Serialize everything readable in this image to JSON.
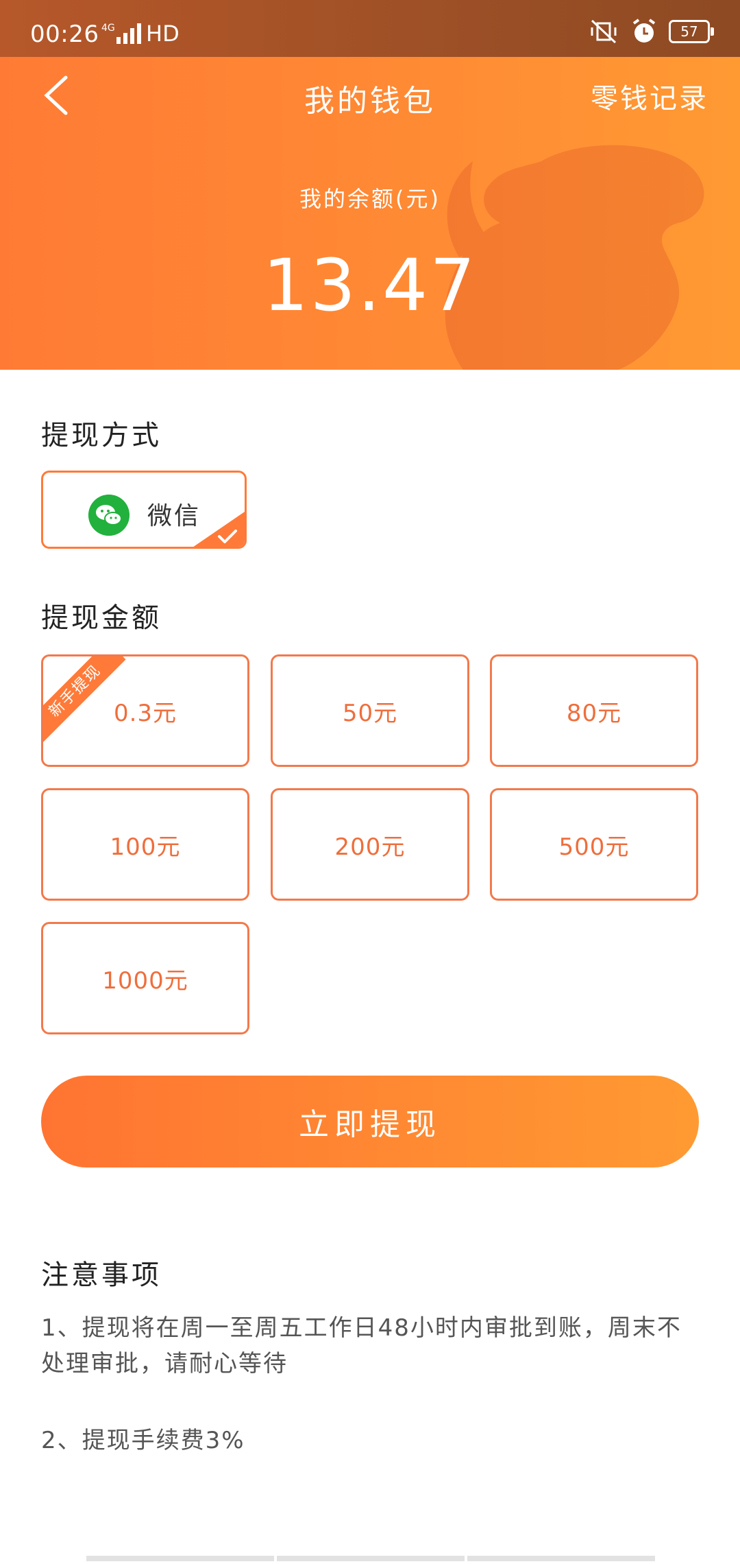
{
  "status_bar": {
    "time": "00:26",
    "network": "4G",
    "hd": "HD",
    "battery": "57",
    "icons": [
      "vibrate-icon",
      "alarm-icon",
      "battery-icon"
    ]
  },
  "nav": {
    "title": "我的钱包",
    "right_link": "零钱记录",
    "back_icon": "chevron-left-icon"
  },
  "balance": {
    "label": "我的余额(元)",
    "value": "13.47"
  },
  "withdraw_method": {
    "title": "提现方式",
    "option_label": "微信",
    "option_icon": "wechat-icon",
    "selected": true
  },
  "withdraw_amount": {
    "title": "提现金额",
    "options": [
      {
        "label": "0.3元",
        "badge": "新手提现"
      },
      {
        "label": "50元"
      },
      {
        "label": "80元"
      },
      {
        "label": "100元"
      },
      {
        "label": "200元"
      },
      {
        "label": "500元"
      },
      {
        "label": "1000元"
      }
    ]
  },
  "withdraw_button": "立即提现",
  "notes": {
    "title": "注意事项",
    "items": [
      "1、提现将在周一至周五工作日48小时内审批到账，周末不处理审批，请耐心等待",
      "2、提现手续费3%"
    ]
  },
  "colors": {
    "accent": "#ff7a38",
    "accent_end": "#ff9a33",
    "status_bar": "#9c4f26",
    "wechat_green": "#22b13d"
  }
}
